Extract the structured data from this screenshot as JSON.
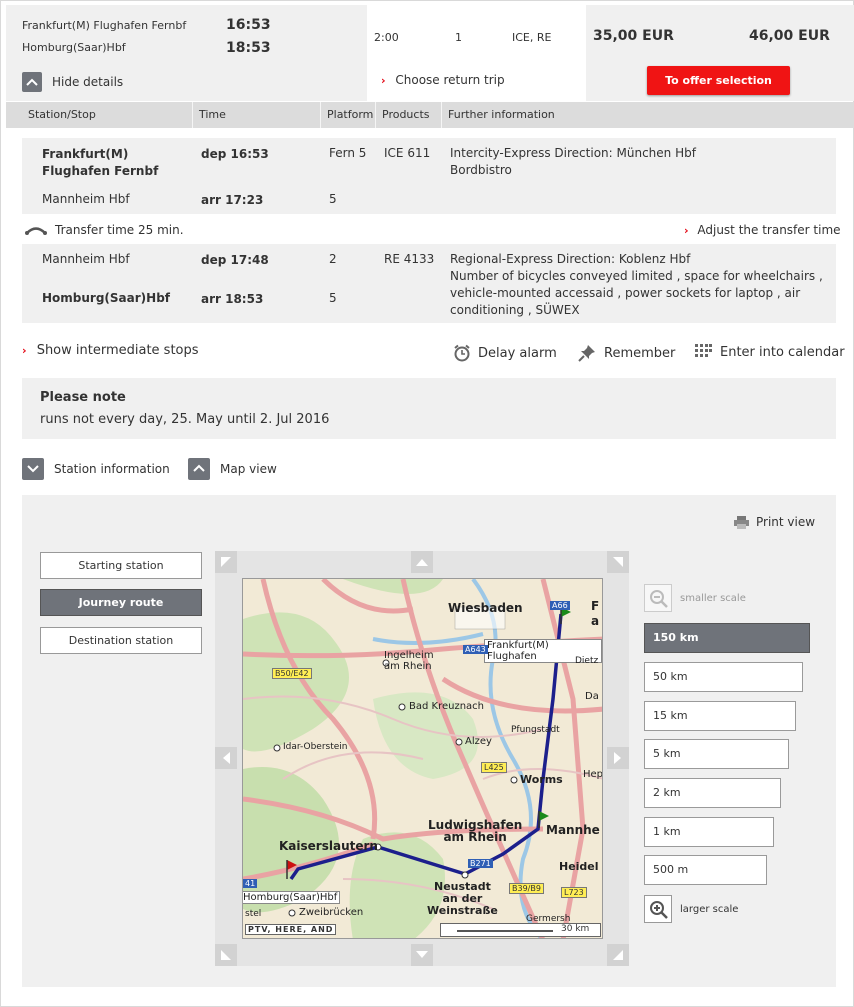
{
  "summary": {
    "from_station": "Frankfurt(M) Flughafen Fernbf",
    "to_station": "Homburg(Saar)Hbf",
    "dep_time": "16:53",
    "arr_time": "18:53",
    "duration": "2:00",
    "changes": "1",
    "products": "ICE, RE",
    "price_1": "35,00 EUR",
    "price_2": "46,00 EUR",
    "hide_details": "Hide details",
    "choose_return": "Choose return trip",
    "offer_selection": "To offer selection"
  },
  "table_headers": [
    "Station/Stop",
    "Time",
    "Platform",
    "Products",
    "Further information"
  ],
  "leg1": {
    "from_line1": "Frankfurt(M)",
    "from_line2": "Flughafen Fernbf",
    "dep": "dep 16:53",
    "dep_platform": "Fern 5",
    "product": "ICE 611",
    "info1": "Intercity-Express Direction: München Hbf",
    "info2": "Bordbistro",
    "to": "Mannheim Hbf",
    "arr": "arr 17:23",
    "arr_platform": "5"
  },
  "transfer": {
    "text": "Transfer time 25 min.",
    "adjust": "Adjust the transfer time"
  },
  "leg2": {
    "from": "Mannheim Hbf",
    "dep": "dep 17:48",
    "dep_platform": "2",
    "product": "RE 4133",
    "info1": "Regional-Express Direction: Koblenz Hbf",
    "info2": "Number of bicycles conveyed limited , space for wheelchairs ,",
    "info3": "vehicle-mounted accessaid , power sockets for laptop , air",
    "info4": "conditioning , SÜWEX",
    "to": "Homburg(Saar)Hbf",
    "arr": "arr 18:53",
    "arr_platform": "5"
  },
  "actions": {
    "show_stops": "Show intermediate stops",
    "delay_alarm": "Delay alarm",
    "remember": "Remember",
    "calendar": "Enter into calendar"
  },
  "note": {
    "title": "Please note",
    "text": "runs not every day, 25. May until 2. Jul 2016"
  },
  "toggles": {
    "station_info": "Station information",
    "map_view": "Map view"
  },
  "map": {
    "print_view": "Print view",
    "stations": [
      "Starting station",
      "Journey route",
      "Destination station"
    ],
    "smaller_scale": "smaller scale",
    "larger_scale": "larger scale",
    "scales": [
      "150 km",
      "50 km",
      "15 km",
      "5 km",
      "2 km",
      "1 km",
      "500 m"
    ],
    "labels": {
      "wiesbaden": "Wiesbaden",
      "ingelheim1": "Ingelheim",
      "ingelheim2": "am Rhein",
      "bad_kreuznach": "Bad Kreuznach",
      "idar": "Idar-Oberstein",
      "alzey": "Alzey",
      "pfungstadt": "Pfungstadt",
      "worms": "Worms",
      "ludwigshafen1": "Ludwigshafen",
      "ludwigshafen2": "am Rhein",
      "mannheim": "Mannhe",
      "heidelberg": "Heidel",
      "kaiserslautern": "Kaiserslautern",
      "neustadt1": "Neustadt",
      "neustadt2": "an der",
      "neustadt3": "Weinstraße",
      "homburg": "Homburg(Saar)Hbf",
      "zweibruecken": "Zweibrücken",
      "stel": "stel",
      "frankfurt_label": "Frankfurt(M) Flughafen",
      "dietz": "Dietz",
      "da": "Da",
      "hep": "Hep",
      "germ": "Germersh",
      "f": "F",
      "a": "a",
      "copyright": "PTV, HERE, AND",
      "scale_bar": "30 km",
      "road_b50": "B50/E42",
      "road_a643": "A643",
      "road_a66": "A66",
      "road_l425": "L425",
      "road_b271": "B271",
      "road_b39": "B39/B9",
      "road_l723": "L723",
      "road_41": "41"
    }
  }
}
